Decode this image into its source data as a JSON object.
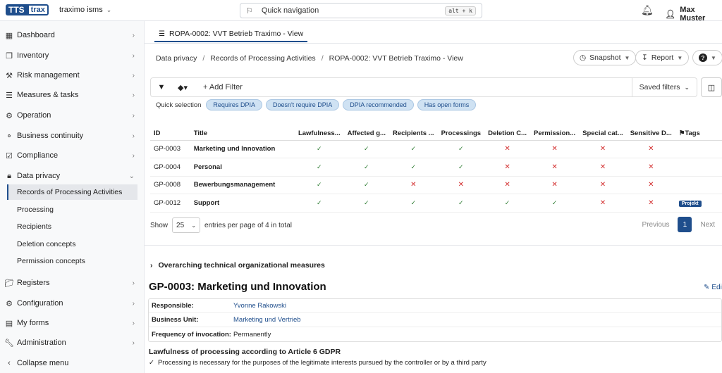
{
  "app": {
    "logo_part1": "TTS",
    "logo_part2": "trax",
    "tenant": "traximo isms",
    "quicknav_label": "Quick navigation",
    "quicknav_shortcut": "alt + k",
    "user_name": "Max Muster"
  },
  "sidebar": {
    "items": [
      {
        "label": "Dashboard",
        "icon": "grid-icon"
      },
      {
        "label": "Inventory",
        "icon": "cubes-icon"
      },
      {
        "label": "Risk management",
        "icon": "hammer-icon"
      },
      {
        "label": "Measures & tasks",
        "icon": "list-icon"
      },
      {
        "label": "Operation",
        "icon": "gear-icon"
      },
      {
        "label": "Business continuity",
        "icon": "lifebuoy-icon"
      },
      {
        "label": "Compliance",
        "icon": "checkbox-icon"
      },
      {
        "label": "Data privacy",
        "icon": "lock-icon"
      },
      {
        "label": "Registers",
        "icon": "folder-icon"
      },
      {
        "label": "Configuration",
        "icon": "gear-icon"
      },
      {
        "label": "My forms",
        "icon": "calendar-icon"
      },
      {
        "label": "Administration",
        "icon": "wrench-icon"
      },
      {
        "label": "Collapse menu",
        "icon": "chevron-left-icon"
      }
    ],
    "subitems": [
      "Records of Processing Activities",
      "Processing",
      "Recipients",
      "Deletion concepts",
      "Permission concepts"
    ]
  },
  "tab": {
    "label": "ROPA-0002: VVT Betrieb Traximo - View"
  },
  "breadcrumb": [
    "Data privacy",
    "Records of Processing Activities",
    "ROPA-0002: VVT Betrieb Traximo - View"
  ],
  "actions": {
    "snapshot": "Snapshot",
    "report": "Report"
  },
  "filter": {
    "add": "Add Filter",
    "saved": "Saved filters"
  },
  "quick_selection": {
    "label": "Quick selection",
    "pills": [
      "Requires DPIA",
      "Doesn't require DPIA",
      "DPIA recommended",
      "Has open forms"
    ]
  },
  "table": {
    "columns": [
      "ID",
      "Title",
      "Lawfulness...",
      "Affected g...",
      "Recipients ...",
      "Processings",
      "Deletion C...",
      "Permission...",
      "Special cat...",
      "Sensitive D...",
      "Tags"
    ],
    "rows": [
      {
        "id": "GP-0003",
        "title": "Marketing und Innovation",
        "flags": [
          true,
          true,
          true,
          true,
          false,
          false,
          false,
          false
        ],
        "tag": ""
      },
      {
        "id": "GP-0004",
        "title": "Personal",
        "flags": [
          true,
          true,
          true,
          true,
          false,
          false,
          false,
          false
        ],
        "tag": ""
      },
      {
        "id": "GP-0008",
        "title": "Bewerbungsmanagement",
        "flags": [
          true,
          true,
          false,
          false,
          false,
          false,
          false,
          false
        ],
        "tag": ""
      },
      {
        "id": "GP-0012",
        "title": "Support",
        "flags": [
          true,
          true,
          true,
          true,
          true,
          true,
          false,
          false
        ],
        "tag": "Projekt"
      }
    ]
  },
  "paging": {
    "show": "Show",
    "per_page": "25",
    "summary": "entries per page of 4 in total",
    "previous": "Previous",
    "current": "1",
    "next": "Next"
  },
  "section": {
    "overarching": "Overarching technical organizational measures"
  },
  "record": {
    "title": "GP-0003: Marketing und Innovation",
    "edit": "Edit",
    "fields": [
      {
        "key": "Responsible:",
        "value": "Yvonne Rakowski",
        "link": true
      },
      {
        "key": "Business Unit:",
        "value": "Marketing und Vertrieb",
        "link": true
      },
      {
        "key": "Frequency of invocation:",
        "value": "Permanently",
        "link": false
      }
    ],
    "lawful_heading": "Lawfulness of processing according to Article 6 GDPR",
    "lawful_item": "Processing is necessary for the purposes of the legitimate interests pursued by the controller or by a third party"
  },
  "colors": {
    "brand": "#1f4e8c",
    "check": "#2e7d32",
    "cross": "#d32f2f"
  }
}
